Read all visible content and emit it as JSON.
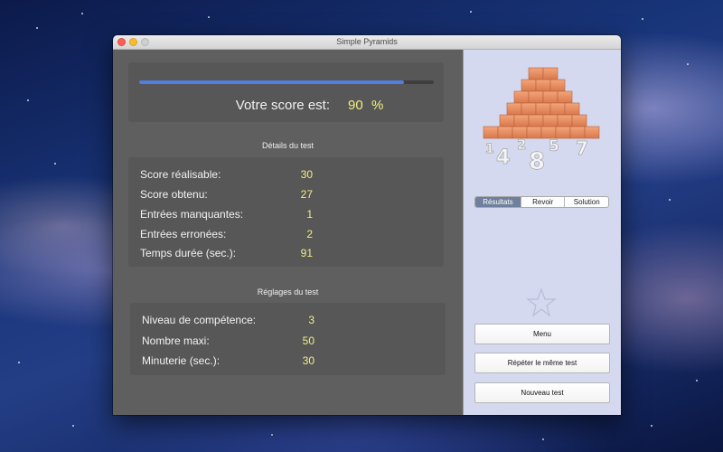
{
  "window": {
    "title": "Simple Pyramids"
  },
  "score": {
    "label": "Votre score est:",
    "value": "90",
    "unit": "%",
    "progress": 0.9
  },
  "details": {
    "title": "Détails du test",
    "rows": [
      {
        "label": "Score réalisable:",
        "value": "30"
      },
      {
        "label": "Score obtenu:",
        "value": "27"
      },
      {
        "label": "Entrées manquantes:",
        "value": "1"
      },
      {
        "label": "Entrées erronées:",
        "value": "2"
      },
      {
        "label": "Temps durée (sec.):",
        "value": "91"
      }
    ]
  },
  "settings": {
    "title": "Réglages du test",
    "rows": [
      {
        "label": "Niveau de compétence:",
        "value": "3"
      },
      {
        "label": "Nombre maxi:",
        "value": "50"
      },
      {
        "label": "Minuterie (sec.):",
        "value": "30"
      }
    ]
  },
  "tabs": [
    {
      "label": "Résultats",
      "active": true
    },
    {
      "label": "Revoir",
      "active": false
    },
    {
      "label": "Solution",
      "active": false
    }
  ],
  "buttons": {
    "menu": "Menu",
    "repeat": "Répéter le même test",
    "new_test": "Nouveau test"
  },
  "pyramid_numbers": [
    "4",
    "8",
    "2",
    "5",
    "7",
    "1"
  ],
  "icons": {
    "star": "star-icon",
    "logo": "pyramid-logo-icon"
  },
  "colors": {
    "accent": "#4f7fe0",
    "value_text": "#f3ee7f",
    "sidebar_bg": "#d5d9ef"
  }
}
